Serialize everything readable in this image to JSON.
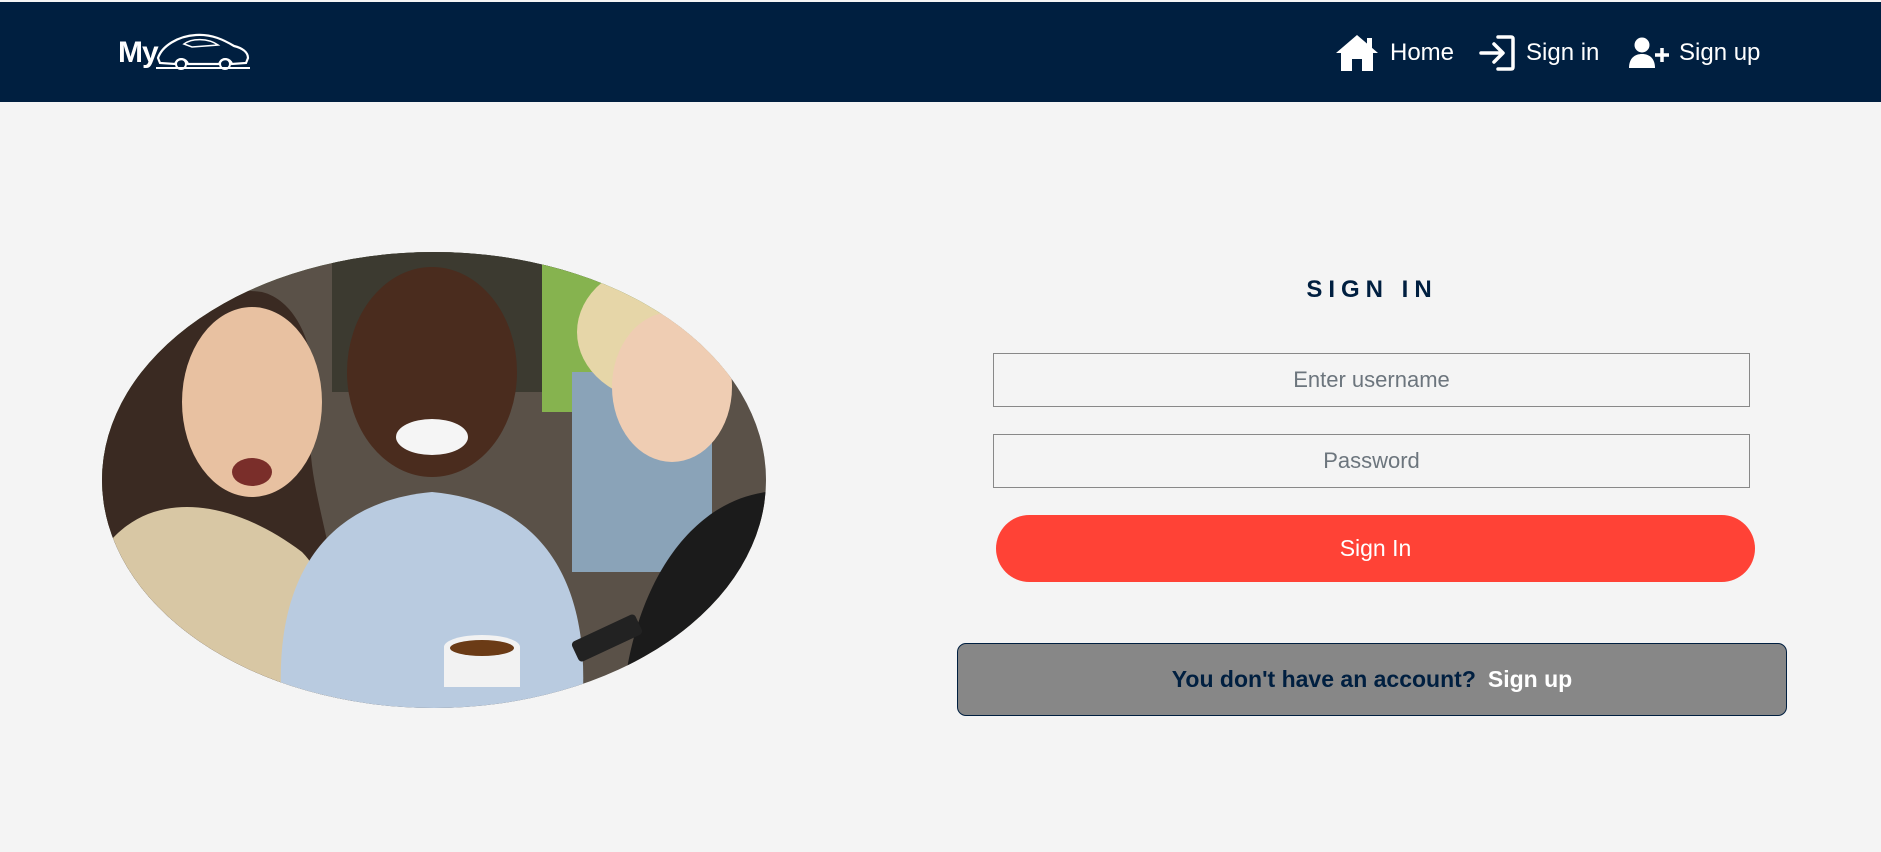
{
  "header": {
    "logo_text": "My",
    "nav": {
      "home": {
        "label": "Home",
        "icon": "home-icon"
      },
      "signin": {
        "label": "Sign in",
        "icon": "sign-in-icon"
      },
      "signup": {
        "label": "Sign up",
        "icon": "user-plus-icon"
      }
    },
    "background_color": "#001f40"
  },
  "main": {
    "form": {
      "title": "SIGN IN",
      "username_placeholder": "Enter username",
      "password_placeholder": "Password",
      "submit_label": "Sign In",
      "submit_color": "#ff4236"
    },
    "account_prompt": {
      "text": "You don't have an account?",
      "link_label": "Sign up"
    }
  }
}
